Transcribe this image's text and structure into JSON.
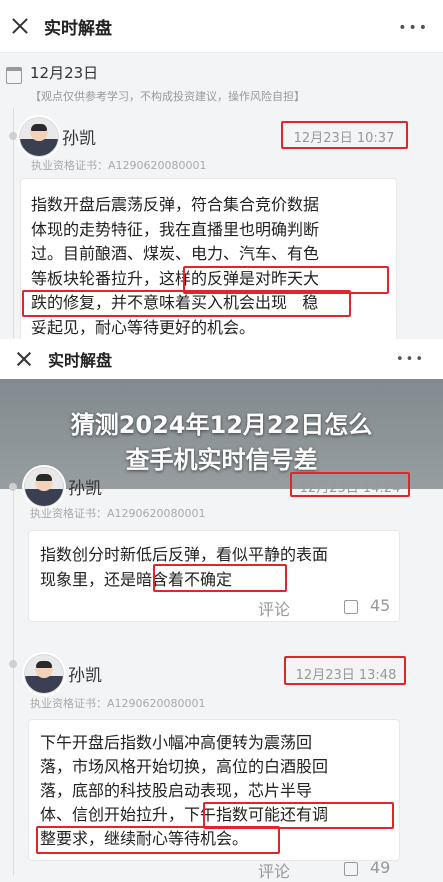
{
  "top_screen": {
    "header_title": "实时解盘",
    "date": "12月23日",
    "note": "【观点仅供参考学习，不构成投资建议，操作风险自担】",
    "post": {
      "author": "孙凯",
      "credential": "执业资格证书：A1290620080001",
      "time": "12月23日 10:37",
      "lines": [
        "指数开盘后震荡反弹，符合集合竞价数据",
        "体现的走势特征，我在直播里也明确判断",
        "过。目前酿酒、煤炭、电力、汽车、有色",
        "等板块轮番拉升，这样的反弹是对昨天大",
        "跌的修复，并不意味着买入机会出现   稳",
        "妥起见，耐心等待更好的机会。"
      ]
    }
  },
  "overlay": {
    "header_title": "实时解盘",
    "banner_line1": "猜测2024年12月22日怎么",
    "banner_line2": "查手机实时信号差",
    "post1": {
      "author": "孙凯",
      "credential": "执业资格证书：A1290620080001",
      "time": "12月23日 14:24",
      "lines": [
        "指数创分时新低后反弹，看似平静的表面",
        "现象里，还是暗含着不确定"
      ],
      "comment_label": "评论",
      "likes": "45"
    },
    "post2": {
      "author": "孙凯",
      "credential": "执业资格证书：A1290620080001",
      "time": "12月23日 13:48",
      "lines": [
        "下午开盘后指数小幅冲高便转为震荡回",
        "落，市场风格开始切换，高位的白酒股回",
        "落，底部的科技股启动表现，芯片半导",
        "体、信创开始拉升，下午指数可能还有调",
        "整要求，继续耐心等待机会。"
      ],
      "comment_label": "评论",
      "likes": "49"
    }
  },
  "colors": {
    "highlight_red": "#e0262a",
    "banner_text": "#ffffff"
  }
}
